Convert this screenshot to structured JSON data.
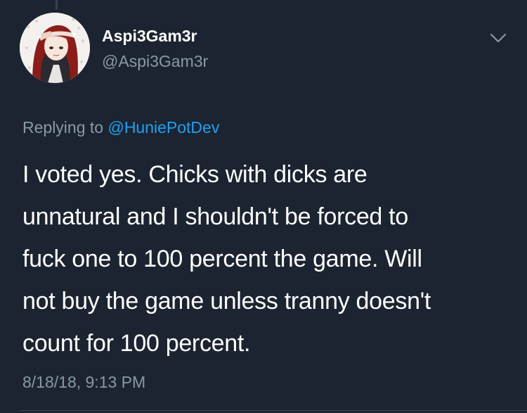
{
  "user": {
    "display_name": "Aspi3Gam3r",
    "handle": "@Aspi3Gam3r",
    "avatar_icon": "avatar-image"
  },
  "reply": {
    "prefix": "Replying to",
    "mention": "@HuniePotDev"
  },
  "tweet": {
    "lines": [
      "I voted yes. Chicks with dicks are",
      "unnatural and I shouldn't be forced to",
      "fuck one to 100 percent the game. Will",
      "not buy the game unless tranny doesn't",
      "count for 100 percent."
    ],
    "timestamp": "8/18/18, 9:13 PM"
  },
  "icons": {
    "menu": "chevron-down-icon"
  },
  "colors": {
    "background": "#1c2431",
    "primary_text": "#ffffff",
    "secondary_text": "#8899a6",
    "link": "#1da1f2"
  }
}
